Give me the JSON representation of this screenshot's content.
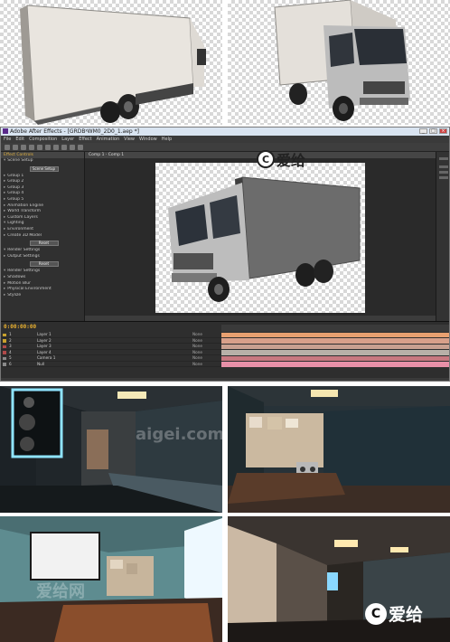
{
  "ae": {
    "window_title": "Adobe After Effects - [GRDB&#7521;WM0_2D0_1.aep *]",
    "menu": [
      "File",
      "Edit",
      "Composition",
      "Layer",
      "Effect",
      "Animation",
      "View",
      "Window",
      "Help"
    ],
    "left_panel_title": "Effect Controls",
    "comp_tab": "Comp 1 · Comp 1",
    "left_rows": [
      "Scene Setup",
      "Group 1",
      "Group 2",
      "Group 3",
      "Group 4",
      "Group 5",
      "Animation Engine",
      "World Transform",
      "Custom Layers",
      "Lighting",
      "Environment",
      "Create 3D Model",
      "Render Settings",
      "Output Settings",
      "Render Settings",
      "Shadows",
      "Motion Blur",
      "Physical Environment",
      "Stylize"
    ],
    "scene_setup_button": "Scene Setup",
    "button_a": "Reset",
    "button_b": "Reset",
    "timecode": "0:00:00:00",
    "layers": [
      {
        "name": "Layer 1",
        "color": "#c9a12d"
      },
      {
        "name": "Layer 2",
        "color": "#c9a12d"
      },
      {
        "name": "Layer 3",
        "color": "#b04a4a"
      },
      {
        "name": "Layer 4",
        "color": "#b04a4a"
      },
      {
        "name": "Camera 1",
        "color": "#8a8a8a"
      },
      {
        "name": "Null",
        "color": "#8a8a8a"
      }
    ],
    "bar_colors": [
      "#e8a070",
      "#d8a08a",
      "#c8a090",
      "#b8b0a8",
      "#c87880",
      "#e890a8"
    ]
  },
  "branding": {
    "icon_glyph": "C",
    "text": "爱给",
    "top_text": "爱给"
  },
  "watermarks": [
    "aigei.com",
    "爱给网"
  ],
  "colors": {
    "accent": "#e8b030",
    "timeline_bg": "#2e2e2e",
    "panel_bg": "#303030"
  }
}
